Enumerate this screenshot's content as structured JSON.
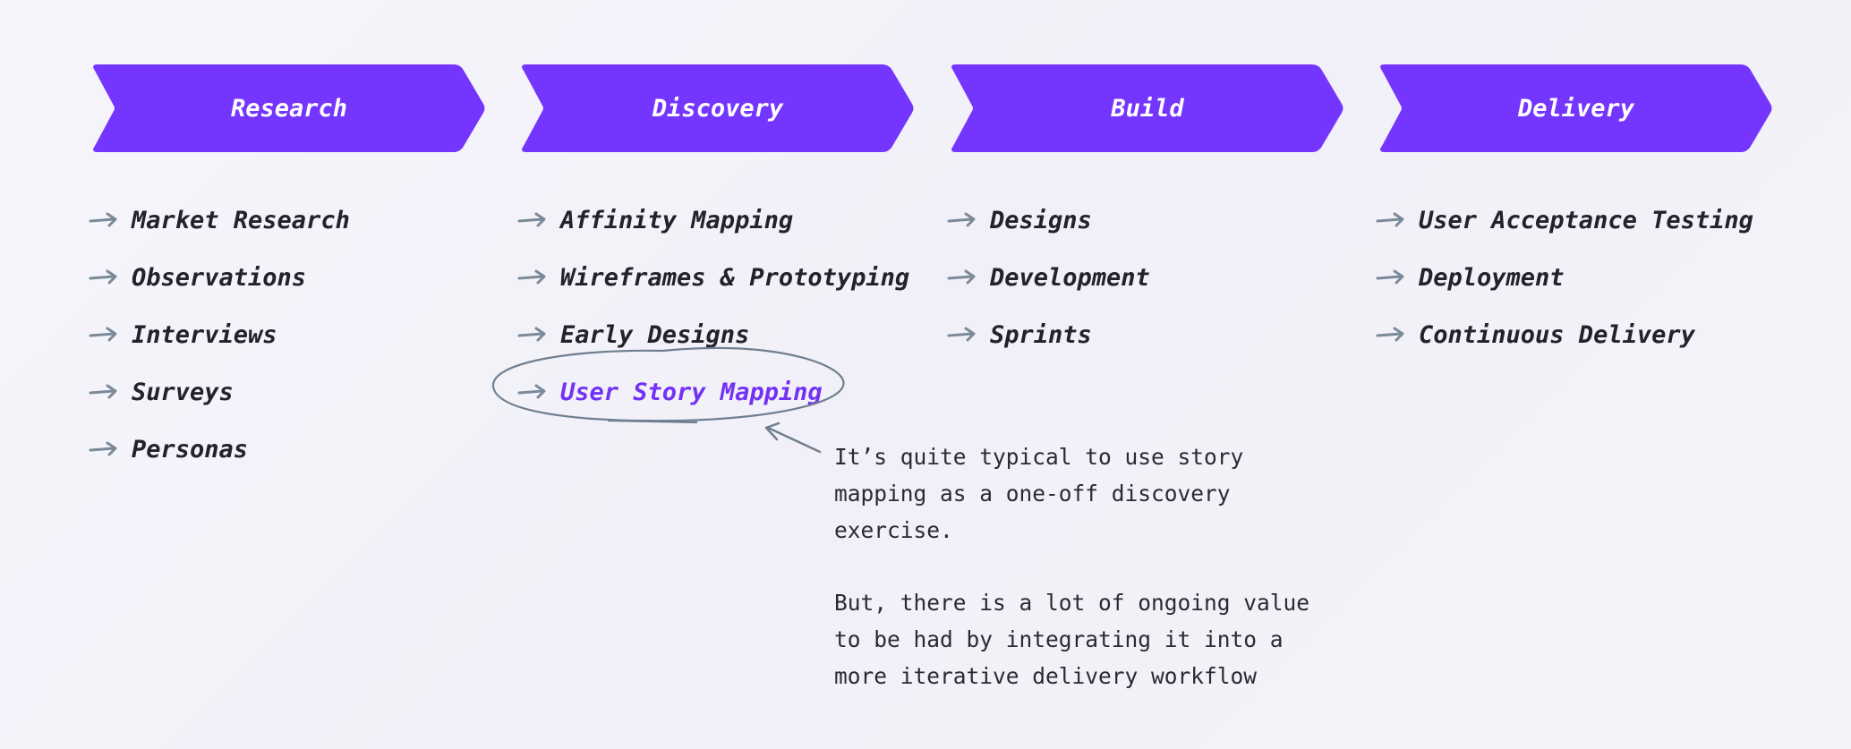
{
  "colors": {
    "accent": "#7435ff",
    "item_text": "#22222c",
    "highlight_text": "#7231f5",
    "arrow": "#7b8a99",
    "annotation_stroke": "#6f7f90"
  },
  "stages": [
    {
      "label": "Research",
      "items": [
        {
          "label": "Market Research",
          "highlighted": false
        },
        {
          "label": "Observations",
          "highlighted": false
        },
        {
          "label": "Interviews",
          "highlighted": false
        },
        {
          "label": "Surveys",
          "highlighted": false
        },
        {
          "label": "Personas",
          "highlighted": false
        }
      ]
    },
    {
      "label": "Discovery",
      "items": [
        {
          "label": "Affinity Mapping",
          "highlighted": false
        },
        {
          "label": "Wireframes & Prototyping",
          "highlighted": false
        },
        {
          "label": "Early Designs",
          "highlighted": false
        },
        {
          "label": "User Story Mapping",
          "highlighted": true
        }
      ]
    },
    {
      "label": "Build",
      "items": [
        {
          "label": "Designs",
          "highlighted": false
        },
        {
          "label": "Development",
          "highlighted": false
        },
        {
          "label": "Sprints",
          "highlighted": false
        }
      ]
    },
    {
      "label": "Delivery",
      "items": [
        {
          "label": "User Acceptance Testing",
          "highlighted": false
        },
        {
          "label": "Deployment",
          "highlighted": false
        },
        {
          "label": "Continuous Delivery",
          "highlighted": false
        }
      ]
    }
  ],
  "annotation": {
    "target": "User Story Mapping",
    "paragraphs": [
      "It’s quite typical to use story mapping as a one-off discovery exercise.",
      "But, there is a lot of ongoing value to be had by integrating it into a more iterative delivery workflow"
    ],
    "lines": [
      [
        "It’s quite typical to use story",
        "mapping as a one-off discovery",
        "exercise."
      ],
      [
        "But, there is a lot of ongoing value",
        "to be had by integrating it into a",
        "more iterative delivery workflow"
      ]
    ]
  }
}
